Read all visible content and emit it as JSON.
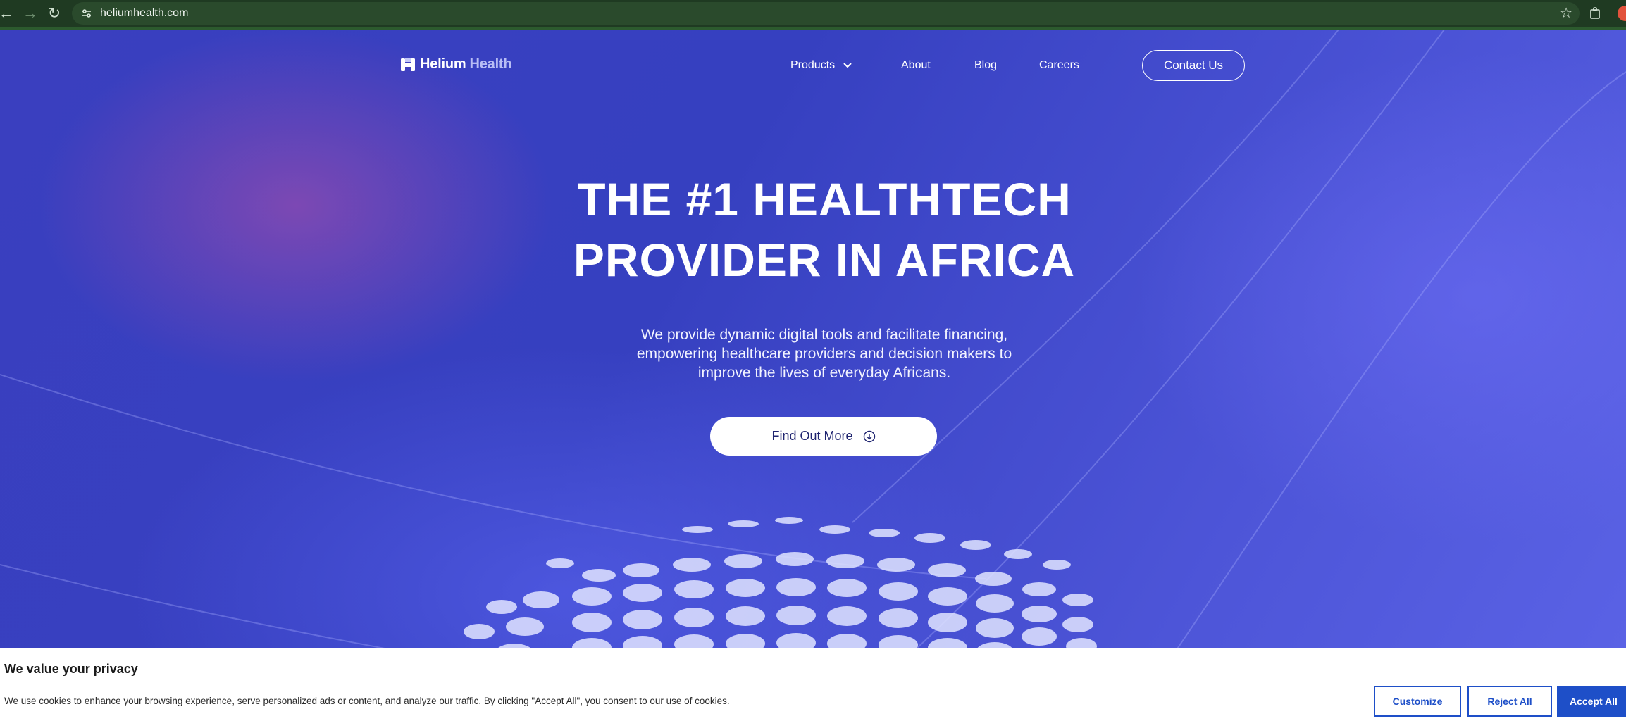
{
  "browser": {
    "url": "heliumhealth.com"
  },
  "header": {
    "logo_primary": "Helium",
    "logo_secondary": "Health",
    "nav": [
      {
        "label": "Products"
      },
      {
        "label": "About"
      },
      {
        "label": "Blog"
      },
      {
        "label": "Careers"
      }
    ],
    "contact_label": "Contact Us"
  },
  "hero": {
    "headline_line1": "THE #1 HEALTHTECH",
    "headline_line2": "PROVIDER IN AFRICA",
    "subtext_line1": "We provide dynamic digital tools and facilitate financing,",
    "subtext_line2": "empowering healthcare providers and decision makers to",
    "subtext_line3": "improve the lives of everyday Africans.",
    "cta_label": "Find Out More"
  },
  "cookie_banner": {
    "title": "We value your privacy",
    "text": "We use cookies to enhance your browsing experience, serve personalized ads or content, and analyze our traffic. By clicking \"Accept All\", you consent to our use of cookies.",
    "customize_label": "Customize",
    "reject_label": "Reject All",
    "accept_label": "Accept All"
  },
  "colors": {
    "accent": "#1e4fc8",
    "hero_bg": "#3b45c4",
    "chrome_bg": "#1f3a22"
  }
}
